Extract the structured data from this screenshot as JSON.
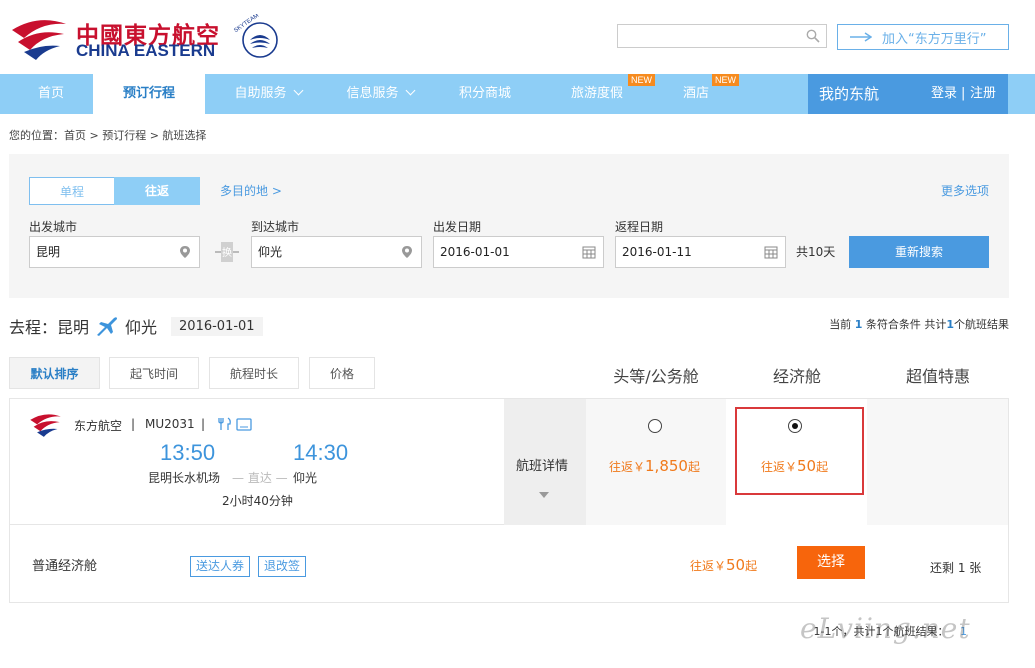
{
  "header": {
    "logo_cn": "中國東方航空",
    "logo_en": "CHINA EASTERN",
    "skyteam": "SKYTEAM",
    "search_placeholder": "",
    "join_label": "加入“东方万里行”"
  },
  "nav": {
    "items": [
      {
        "label": "首页"
      },
      {
        "label": "预订行程"
      },
      {
        "label": "自助服务"
      },
      {
        "label": "信息服务"
      },
      {
        "label": "积分商城"
      },
      {
        "label": "旅游度假",
        "badge": "NEW"
      },
      {
        "label": "酒店",
        "badge": "NEW"
      }
    ],
    "my_ce": "我的东航",
    "login": "登录",
    "sep": "|",
    "register": "注册"
  },
  "breadcrumb": "您的位置：首页 > 预订行程 > 航班选择",
  "search_panel": {
    "tab_oneway": "单程",
    "tab_roundtrip": "往返",
    "multi": "多目的地 >",
    "more_options": "更多选项",
    "from_label": "出发城市",
    "from_value": "昆明",
    "swap_label": "换",
    "to_label": "到达城市",
    "to_value": "仰光",
    "depart_label": "出发日期",
    "depart_value": "2016-01-01",
    "return_label": "返程日期",
    "return_value": "2016-01-11",
    "days": "共10天",
    "search_btn": "重新搜索"
  },
  "route": {
    "prefix": "去程：昆明",
    "dest": "仰光",
    "date": "2016-01-01",
    "count_pre": "当前",
    "count_num": "1",
    "count_mid": "条符合条件 共计",
    "count_total": "1",
    "count_post": "个航班结果"
  },
  "sort": {
    "default": "默认排序",
    "depart_time": "起飞时间",
    "duration": "航程时长",
    "price": "价格"
  },
  "cabins": {
    "first": "头等/公务舱",
    "economy": "经济舱",
    "special": "超值特惠"
  },
  "flight": {
    "airline": "东方航空",
    "sep": "|",
    "flight_no": "MU2031",
    "dep_time": "13:50",
    "arr_time": "14:30",
    "dep_airport": "昆明长水机场",
    "direct": "直达",
    "arr_airport": "仰光",
    "duration": "2小时40分钟",
    "detail_label": "航班详情",
    "biz_price_pre": "往返￥",
    "biz_price": "1,850",
    "biz_price_post": "起",
    "econ_price_pre": "往返￥",
    "econ_price": "50",
    "econ_price_post": "起"
  },
  "fare": {
    "name": "普通经济舱",
    "tag1": "送达人券",
    "tag2": "退改签",
    "price_pre": "往返￥",
    "price": "50",
    "price_post": "起",
    "select": "选择",
    "remaining": "还剩 1 张"
  },
  "pager": {
    "text": "1-1个，共计1个航班结果：",
    "page": "1"
  },
  "watermark": "eLviing.net",
  "colors": {
    "brand_red": "#c8102e",
    "brand_blue": "#1a3b8f",
    "nav": "#8ecef6",
    "accent": "#4a9ae0",
    "price": "#f07a1c",
    "select": "#f7650c",
    "highlight": "#d9393b"
  }
}
